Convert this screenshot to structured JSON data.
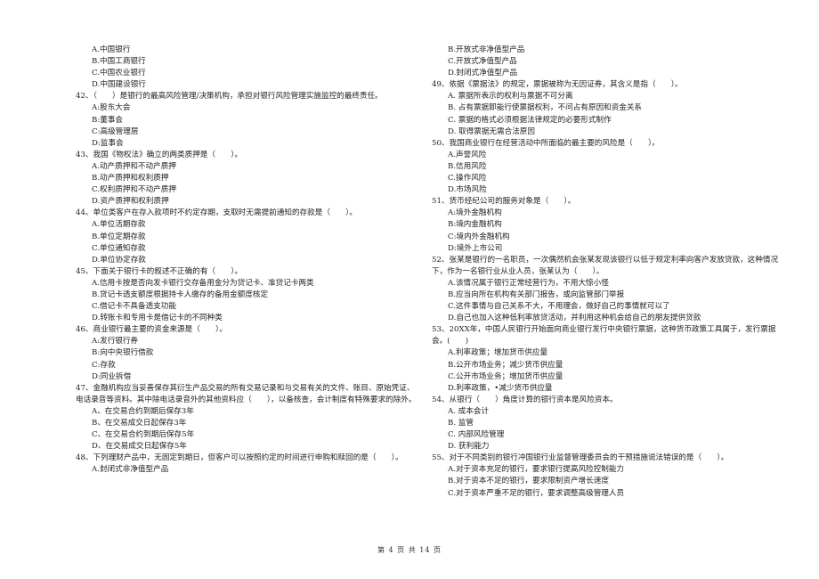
{
  "left_column": {
    "continued_options": [
      "A.中国银行",
      "B.中国工商银行",
      "C.中国农业银行",
      "D.中国建设银行"
    ],
    "questions": [
      {
        "stem": "42、（　　）是银行的最高风险管理/决策机构，承担对银行风险管理实施监控的最终责任。",
        "options": [
          "A:股东大会",
          "B:董事会",
          "C:高级管理层",
          "D:监事会"
        ]
      },
      {
        "stem": "43、我国《物权法》确立的两类质押是（　　）。",
        "options": [
          "A.动产质押和不动产质押",
          "B.动产质押和权利质押",
          "C.权利质押和不动产质押",
          "D.资产质押和权利质押"
        ]
      },
      {
        "stem": "44、单位类客户在存入款项时不约定存期，支取时无需提前通知的存款是（　　）。",
        "options": [
          "A.单位活期存款",
          "B.单位定期存款",
          "C.单位通知存款",
          "D.单位协定存款"
        ]
      },
      {
        "stem": "45、下面关于银行卡的叙述不正确的有（　　）。",
        "options": [
          "A.信用卡按是否向发卡银行交存备用金分为贷记卡、准贷记卡两类",
          "B.贷记卡透支额度根据持卡人缴存的备用金额度核定",
          "C.借记卡不具备透支功能",
          "D.转账卡和专用卡是借记卡的不同种类"
        ]
      },
      {
        "stem": "46、商业银行最主要的资金来源是（　　）。",
        "options": [
          "A:发行银行券",
          "B:向中央银行借款",
          "C:存款",
          "D:同业拆借"
        ]
      },
      {
        "stem": "47、金融机构应当妥善保存其衍生产品交易的所有交易记录和与交易有关的文件、账目、原始凭证、电话录音等资料。其中除电话录音外的其他资料应（　　），以备核查，会计制度有特殊要求的除外。",
        "options": [
          "A、在交易合约到期后保存3年",
          "B、在交易成交日起保存3年",
          "C、在交易合约到期后保存5年",
          "D、在交易成交日起保存5年"
        ]
      },
      {
        "stem": "48、下列理财产品中，无固定到期日，但客户可以按照约定的时间进行申购和赎回的是（　　）。",
        "options": [
          "A.封闭式非净值型产品"
        ]
      }
    ]
  },
  "right_column": {
    "continued_options": [
      "B.开放式非净值型产品",
      "C.开放式净值型产品",
      "D.封闭式净值型产品"
    ],
    "questions": [
      {
        "stem": "49、依据《票据法》的规定，票据被称为无因证券，其含义是指（　　）。",
        "options": [
          "A.  票据所表示的权利与票据不可分离",
          "B.  占有票据即能行使票据权利，不问占有原因和资金关系",
          "C.  票据的格式必须根据法律规定的必要形式制作",
          "D.  取得票据无需合法原因"
        ]
      },
      {
        "stem": "50、我国商业银行在经营活动中所面临的最主要的风险是（　　）。",
        "options": [
          "A.声誉风险",
          "B.信用风险",
          "C.操作风险",
          "D.市场风险"
        ]
      },
      {
        "stem": "51、货币经纪公司的服务对象是（　　）。",
        "options": [
          "A:境外金融机构",
          "B:境内金融机构",
          "C:境内外金融机构",
          "D:境外上市公司"
        ]
      },
      {
        "stem": "52、张某是银行的一名职员，一次偶然机会张某发现该银行以低于规定利率向客户发放贷款，这种情况下，作为一名银行业从业人员，张某认为（　　）。",
        "options": [
          "A.该情况属于银行正常经营行为，不用大惊小怪",
          "B.应当向所在机构有关部门报告，或向监管部门举报",
          "C.这件事情与自己关系不大，不用理会，做好自己的事情就可以了",
          "D.自己也加入这种低利率放贷活动，并利用这种机会给自己的朋友提供贷款"
        ]
      },
      {
        "stem": "53、20XX年，中国人民银行开始面向商业银行发行中央银行票据，这种货币政策工具属于，发行票据会。(　　)",
        "options": [
          "A.利率政策；增加货币供应量",
          "B.公开市场业务；减少货币供应量",
          "C.公开市场业务；增加货币供应量",
          "D.利率政策，•减少货币供应量"
        ]
      },
      {
        "stem": "54、从银行（　　）角度计算的银行资本是风险资本。",
        "options": [
          "A.  成本会计",
          "B.  监管",
          "C.  内部风险管理",
          "D.  获利能力"
        ]
      },
      {
        "stem": "55、对于不同类别的银行冲国银行业监督管理委员会的干预措施说法错误的是（　　）。",
        "options": [
          "A.对于资本充足的银行，要求银行提高风险控制能力",
          "B.对于资本不足的银行，要求限制资产增长速度",
          "C.对于资本严重不足的银行，要求调整高级管理人员"
        ]
      }
    ]
  },
  "footer": {
    "page_label": "第 4 页 共 14 页"
  }
}
